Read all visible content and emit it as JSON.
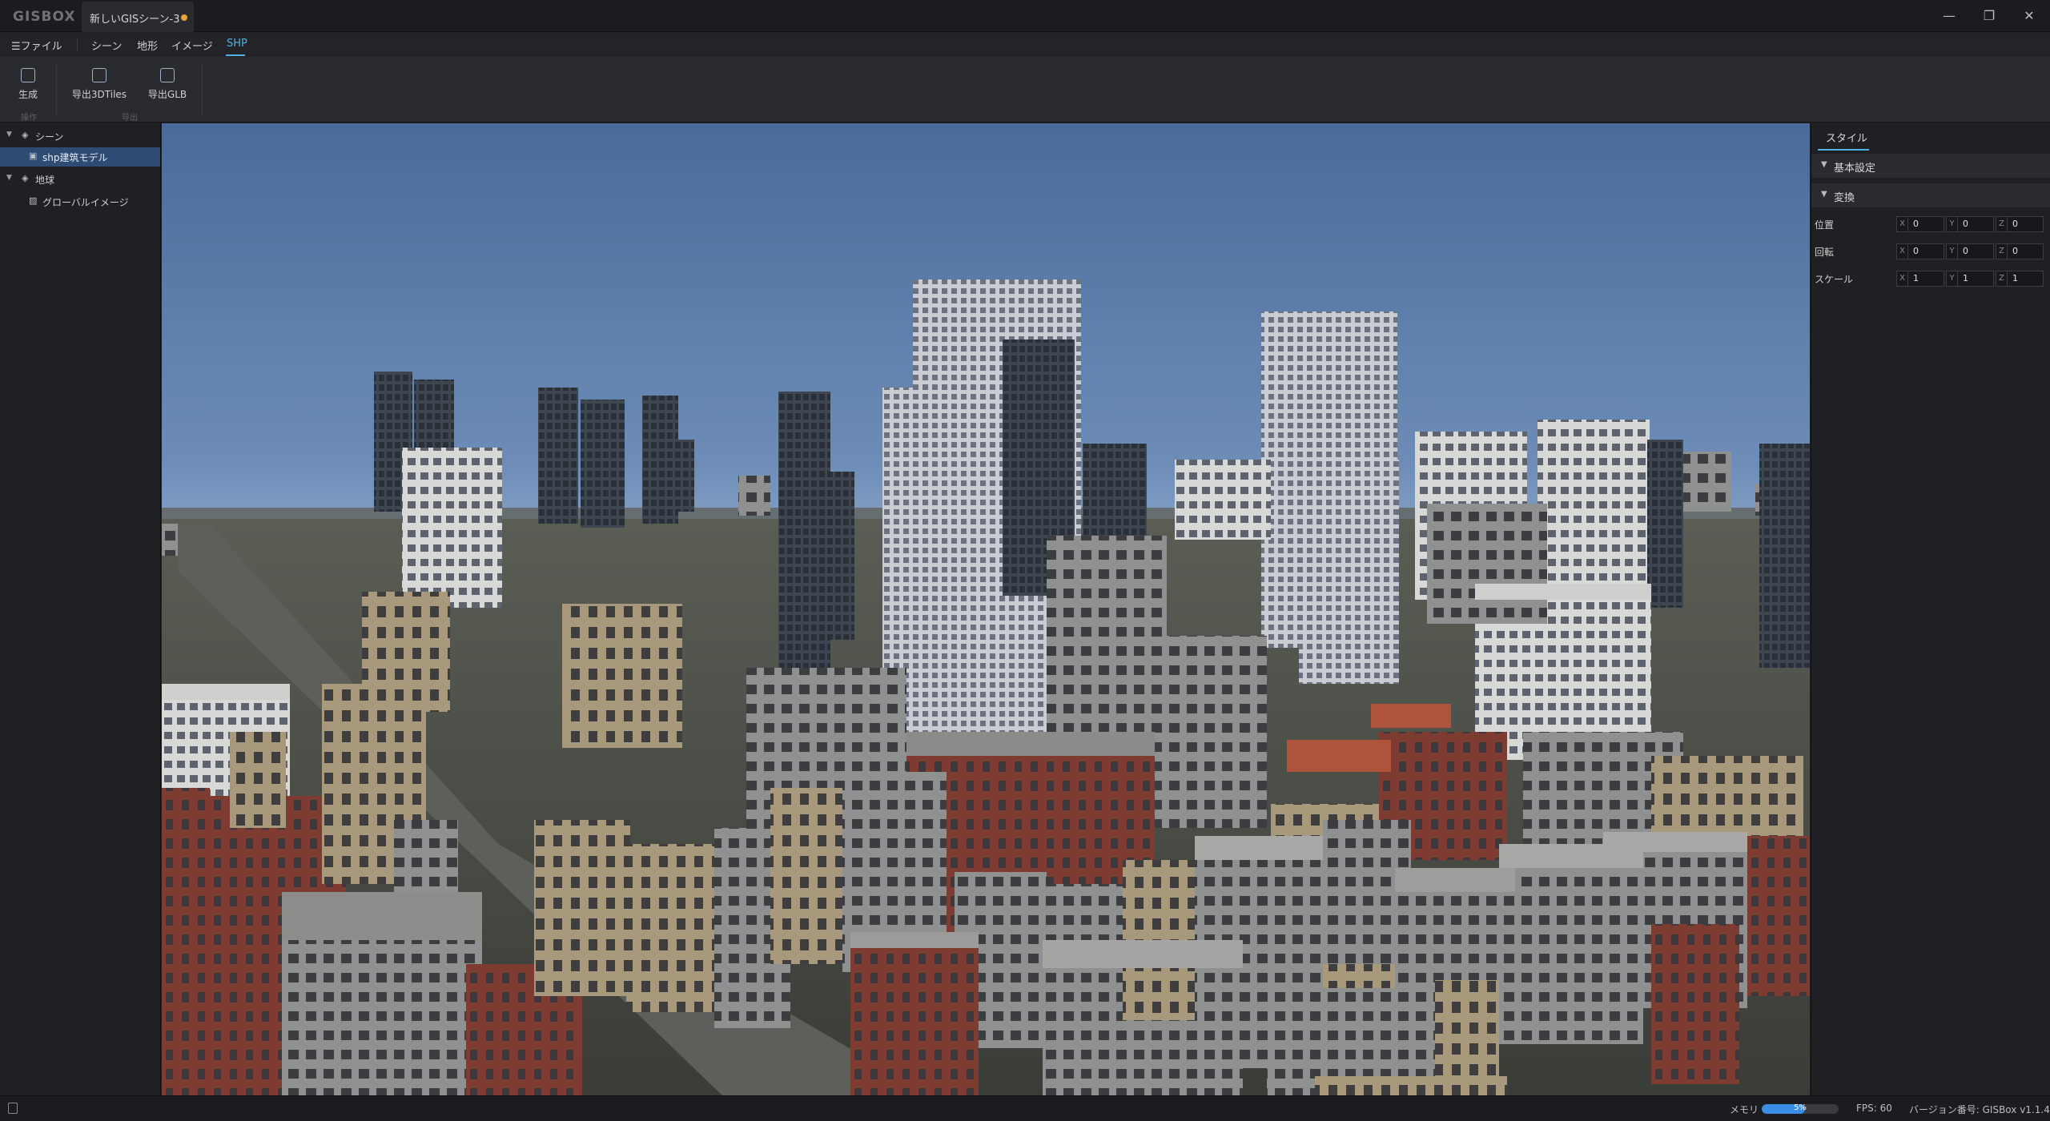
{
  "app": {
    "logo": "GISBOX",
    "doc_tab": "新しいGISシーン-3",
    "window_controls": {
      "minimize": "—",
      "maximize": "❐",
      "close": "✕"
    }
  },
  "menu": {
    "file": "☰ファイル",
    "scene": "シーン",
    "terrain": "地形",
    "image": "イメージ",
    "shp": "SHP"
  },
  "ribbon": {
    "generate": "生成",
    "export_3dtiles": "导出3DTiles",
    "export_glb": "导出GLB",
    "group_operation": "操作",
    "group_export": "导出"
  },
  "tree": {
    "scene": "シーン",
    "shp_model": "shp建筑モデル",
    "earth": "地球",
    "global_image": "グローバルイメージ"
  },
  "right_panel": {
    "tab": "スタイル",
    "section_basic": "基本設定",
    "section_transform": "変換",
    "axes": {
      "x": "X",
      "y": "Y",
      "z": "Z"
    },
    "position": {
      "label": "位置",
      "x": "0",
      "y": "0",
      "z": "0"
    },
    "rotation": {
      "label": "回転",
      "x": "0",
      "y": "0",
      "z": "0"
    },
    "scale": {
      "label": "スケール",
      "x": "1",
      "y": "1",
      "z": "1"
    }
  },
  "status": {
    "memory_label": "メモリ",
    "memory_percent": "5%",
    "memory_fraction": 0.56,
    "fps": "FPS: 60",
    "version": "バージョン番号: GISBox v1.1.4"
  },
  "colors": {
    "accent": "#4fb3e8",
    "selection": "#2d4b73",
    "unsaved_dot": "#e8a33a",
    "sky_top": "#4a6a9a",
    "sky_bottom": "#b9cde0"
  }
}
